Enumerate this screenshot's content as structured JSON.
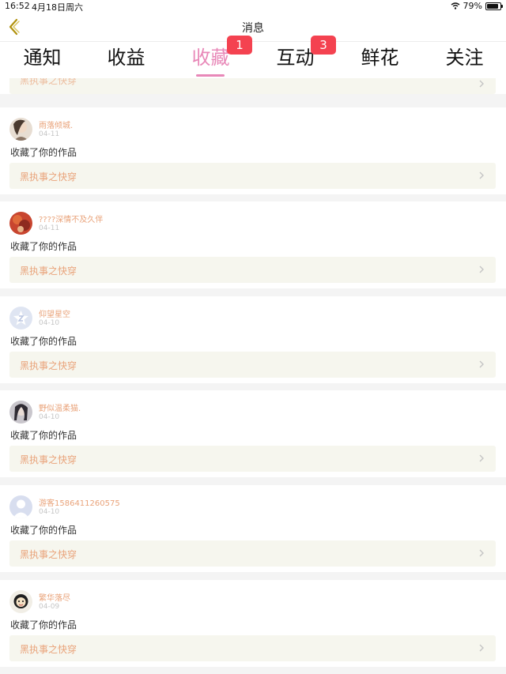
{
  "status_bar": {
    "time": "16:52",
    "date": "4月18日周六",
    "battery": "79%"
  },
  "header": {
    "title": "消息"
  },
  "tabs": [
    {
      "label": "通知",
      "badge": ""
    },
    {
      "label": "收益",
      "badge": ""
    },
    {
      "label": "收藏",
      "badge": "1"
    },
    {
      "label": "互动",
      "badge": "3"
    },
    {
      "label": "鲜花",
      "badge": ""
    },
    {
      "label": "关注",
      "badge": ""
    }
  ],
  "partial_item": {
    "work": "黑执事之快穿"
  },
  "items": [
    {
      "user": "雨落倾城.",
      "date": "04-11",
      "action": "收藏了你的作品",
      "work": "黑执事之快穿",
      "avatar_color": "#6b5a4e"
    },
    {
      "user": "????深情不及久伴",
      "date": "04-11",
      "action": "收藏了你的作品",
      "work": "黑执事之快穿",
      "avatar_color": "#b33a2a"
    },
    {
      "user": "仰望星空",
      "date": "04-10",
      "action": "收藏了你的作品",
      "work": "黑执事之快穿",
      "avatar_color": "#dfe5f2"
    },
    {
      "user": "野似温柔猫.",
      "date": "04-10",
      "action": "收藏了你的作品",
      "work": "黑执事之快穿",
      "avatar_color": "#5a5560"
    },
    {
      "user": "游客1586411260575",
      "date": "04-10",
      "action": "收藏了你的作品",
      "work": "黑执事之快穿",
      "avatar_color": "#d8deef"
    },
    {
      "user": "繁华落尽",
      "date": "04-09",
      "action": "收藏了你的作品",
      "work": "黑执事之快穿",
      "avatar_color": "#3a3a3a"
    }
  ],
  "colors": {
    "accent": "#e888b8",
    "badge": "#f44250",
    "username": "#e9a37a",
    "work_bg": "#f6f6ee"
  },
  "icons": {
    "back": "chevron-left-icon",
    "row_arrow": "chevron-right-icon",
    "wifi": "wifi-icon",
    "battery": "battery-icon"
  }
}
